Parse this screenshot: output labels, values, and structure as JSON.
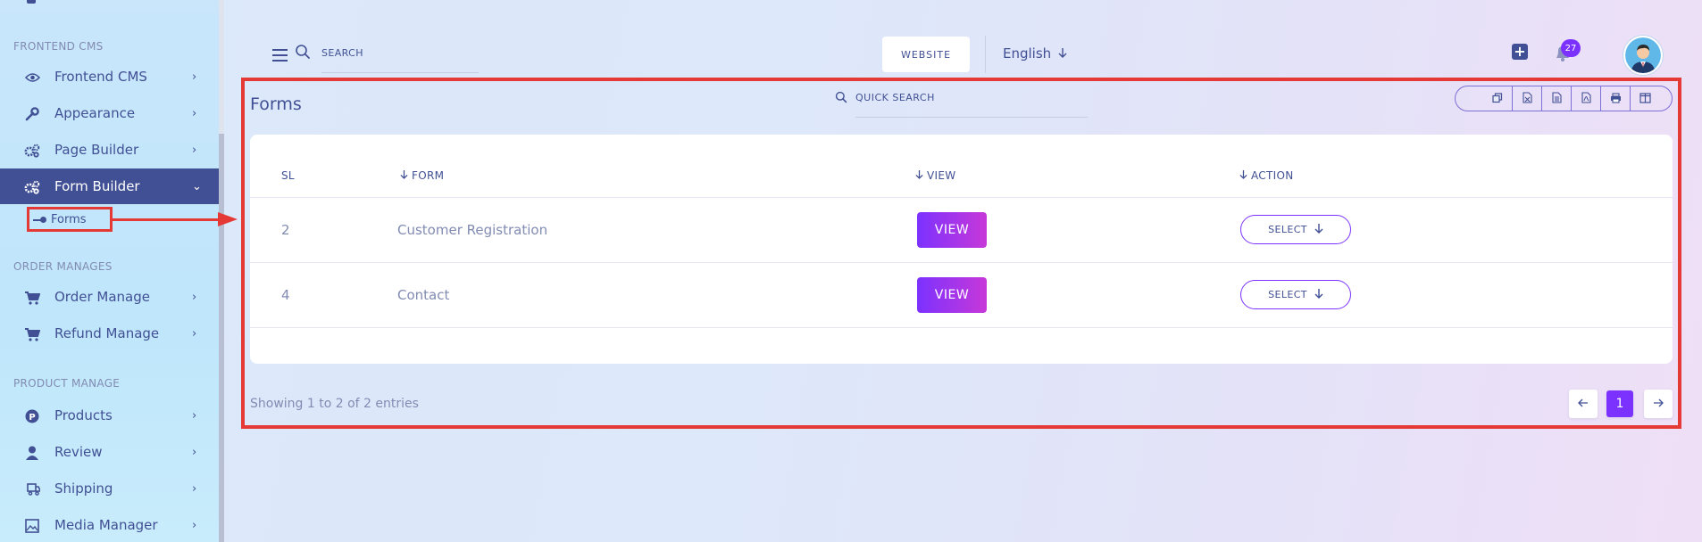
{
  "sidebar": {
    "sections": {
      "frontend": "FRONTEND CMS",
      "order": "ORDER MANAGES",
      "product": "PRODUCT MANAGE"
    },
    "items": [
      {
        "label": "Frontend CMS",
        "icon": "eye-icon"
      },
      {
        "label": "Appearance",
        "icon": "wrench-icon"
      },
      {
        "label": "Page Builder",
        "icon": "gears-icon"
      },
      {
        "label": "Form Builder",
        "icon": "gears-icon",
        "active": true
      },
      {
        "label": "Order Manage",
        "icon": "cart-icon"
      },
      {
        "label": "Refund Manage",
        "icon": "cart-icon"
      },
      {
        "label": "Products",
        "icon": "product-p-icon"
      },
      {
        "label": "Review",
        "icon": "user-icon"
      },
      {
        "label": "Shipping",
        "icon": "truck-icon"
      },
      {
        "label": "Media Manager",
        "icon": "image-icon"
      }
    ],
    "sub_item": "Forms"
  },
  "header": {
    "search_placeholder": "SEARCH",
    "website_label": "WEBSITE",
    "language": "English",
    "notification_count": "27"
  },
  "main": {
    "title": "Forms",
    "quick_search_placeholder": "QUICK SEARCH",
    "export_buttons": [
      "copy-icon",
      "excel-icon",
      "csv-icon",
      "pdf-icon",
      "print-icon",
      "columns-icon"
    ],
    "columns": {
      "sl": "SL",
      "form": "FORM",
      "view": "VIEW",
      "action": "ACTION"
    },
    "rows": [
      {
        "sl": "2",
        "form": "Customer Registration",
        "view": "VIEW",
        "action": "SELECT"
      },
      {
        "sl": "4",
        "form": "Contact",
        "view": "VIEW",
        "action": "SELECT"
      }
    ],
    "entries_text": "Showing 1 to 2 of 2 entries",
    "current_page": "1"
  },
  "colors": {
    "accent": "#7c32ff",
    "nav_active": "#415094",
    "highlight": "#e53935"
  }
}
